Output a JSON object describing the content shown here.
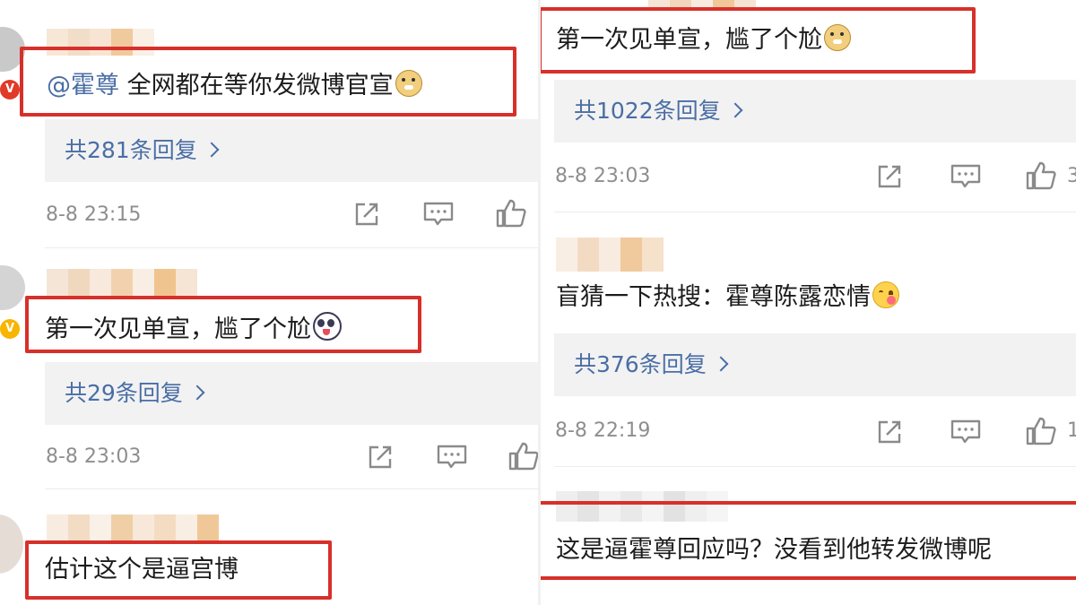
{
  "colors": {
    "accent": "#4a6ea5",
    "highlight_box": "#d7302a",
    "verified_badge": "#f7b500",
    "red_badge": "#e03a28"
  },
  "left": {
    "comments": [
      {
        "mention": "@霍尊",
        "text": " 全网都在等你发微博官宣",
        "emoji": "doge-emoji",
        "replies": "共281条回复",
        "time": "8-8 23:15",
        "badge": "V"
      },
      {
        "mention": "",
        "text": "第一次见单宣，尴了个尬",
        "emoji": "panda-emoji",
        "replies": "共29条回复",
        "time": "8-8 23:03",
        "badge": "V"
      },
      {
        "mention": "",
        "text": "估计这个是逼宫博",
        "emoji": ""
      }
    ]
  },
  "right": {
    "comments": [
      {
        "text": "第一次见单宣，尴了个尬",
        "emoji": "doge-emoji",
        "replies": "共1022条回复",
        "time": "8-8 23:03",
        "like_count_partial": "3"
      },
      {
        "text": "盲猜一下热搜：霍尊陈露恋情",
        "emoji": "yum-emoji",
        "replies": "共376条回复",
        "time": "8-8 22:19",
        "like_count_partial": "1"
      },
      {
        "text": "这是逼霍尊回应吗？没看到他转发微博呢"
      }
    ]
  },
  "icons": {
    "share": "share-icon",
    "comment": "comment-icon",
    "like": "like-icon",
    "chevron": "chevron-right-icon"
  }
}
